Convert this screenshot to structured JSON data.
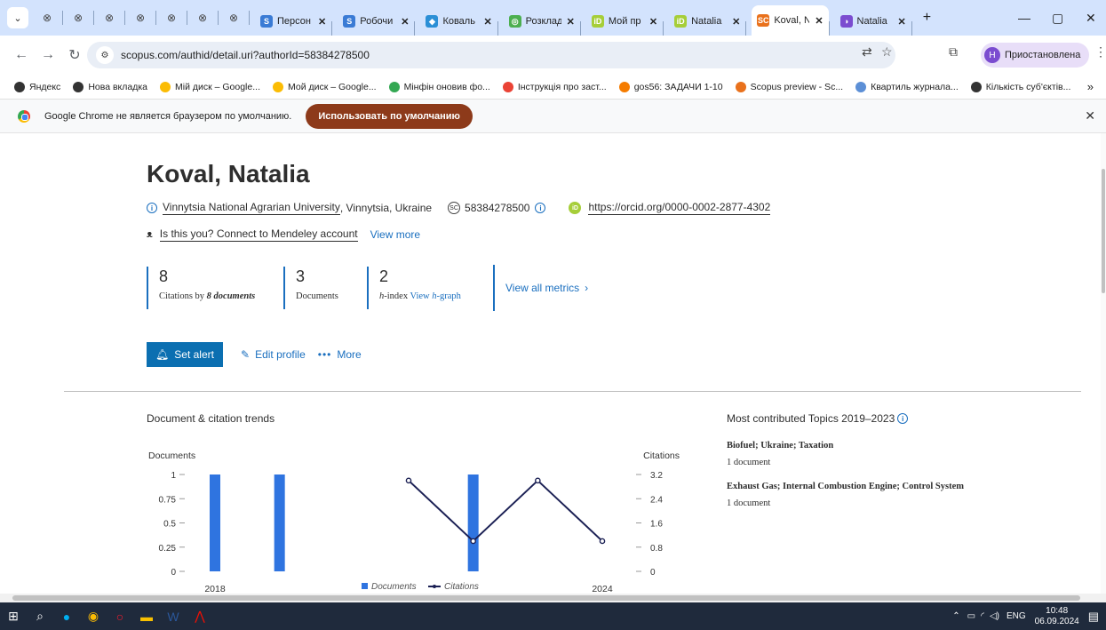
{
  "browser": {
    "tabs": [
      {
        "label": "Персон",
        "icon": "S",
        "color": "#3a7bd5"
      },
      {
        "label": "Робочи",
        "icon": "S",
        "color": "#3a7bd5"
      },
      {
        "label": "Коваль",
        "icon": "◆",
        "color": "#2b8fd6"
      },
      {
        "label": "Розклад",
        "icon": "◎",
        "color": "#4caf50"
      },
      {
        "label": "Мой пр",
        "icon": "iD",
        "color": "#a6ce39"
      },
      {
        "label": "Natalia",
        "icon": "iD",
        "color": "#a6ce39"
      },
      {
        "label": "Koval, N",
        "icon": "SC",
        "color": "#e9711c",
        "active": true
      },
      {
        "label": "Natalia",
        "icon": "◑",
        "color": "#7b4cd0"
      }
    ],
    "url": "scopus.com/authid/detail.uri?authorId=58384278500",
    "profile_label": "Приостановлена",
    "profile_initial": "Н",
    "bookmarks": [
      {
        "label": "Яндекс",
        "color": "#333"
      },
      {
        "label": "Нова вкладка",
        "color": "#333"
      },
      {
        "label": "Мій диск – Google...",
        "color": "#fbbc04"
      },
      {
        "label": "Мой диск – Google...",
        "color": "#fbbc04"
      },
      {
        "label": "Мінфін оновив фо...",
        "color": "#34a853"
      },
      {
        "label": "Інструкція про заст...",
        "color": "#ea4335"
      },
      {
        "label": "gos56: ЗАДАЧИ 1-10",
        "color": "#f57c00"
      },
      {
        "label": "Scopus preview - Sc...",
        "color": "#e9711c"
      },
      {
        "label": "Квартиль журнала...",
        "color": "#5c8fd6"
      },
      {
        "label": "Кількість суб'єктів...",
        "color": "#333"
      }
    ],
    "infobar_text": "Google Chrome не является браузером по умолчанию.",
    "infobar_button": "Использовать по умолчанию"
  },
  "profile": {
    "name": "Koval, Natalia",
    "affiliation": "Vinnytsia National Agrarian University",
    "location": ", Vinnytsia, Ukraine",
    "scopus_id": "58384278500",
    "orcid": "https://orcid.org/0000-0002-2877-4302",
    "mendeley": "Is this you? Connect to Mendeley account",
    "view_more": "View more"
  },
  "metrics": {
    "citations": "8",
    "citations_label_prefix": "Citations by ",
    "citations_label_em": "8 documents",
    "documents": "3",
    "documents_label": "Documents",
    "hindex": "2",
    "hindex_label_em": "h",
    "hindex_label": "-index ",
    "hgraph_link": "View ",
    "hgraph_em": "h",
    "hgraph_link2": "-graph",
    "view_all": "View all metrics"
  },
  "actions": {
    "set_alert": "Set alert",
    "edit_profile": "Edit profile",
    "more": "More"
  },
  "trends_title": "Document & citation trends",
  "topics": {
    "title": "Most contributed Topics 2019–2023",
    "items": [
      {
        "name": "Biofuel; Ukraine; Taxation",
        "count": "1 document"
      },
      {
        "name": "Exhaust Gas; Internal Combustion Engine; Control System",
        "count": "1 document"
      }
    ]
  },
  "chart_data": {
    "type": "bar",
    "left_axis_label": "Documents",
    "right_axis_label": "Citations",
    "left_ticks": [
      "1",
      "0.75",
      "0.5",
      "0.25",
      "0"
    ],
    "right_ticks": [
      "3.2",
      "2.4",
      "1.6",
      "0.8",
      "0"
    ],
    "x_tick_labels": [
      "2018",
      "2024"
    ],
    "ylim_documents": [
      0,
      1
    ],
    "ylim_citations": [
      0,
      3.2
    ],
    "x": [
      2018,
      2019,
      2020,
      2021,
      2022,
      2023,
      2024
    ],
    "series": [
      {
        "name": "Documents",
        "kind": "bar",
        "color": "#2f74e0",
        "values": [
          1,
          1,
          0,
          0,
          1,
          0,
          0
        ]
      },
      {
        "name": "Citations",
        "kind": "line",
        "color": "#1b2054",
        "values": [
          null,
          null,
          null,
          3,
          1,
          3,
          1
        ]
      }
    ],
    "legend": [
      "Documents",
      "Citations"
    ]
  },
  "taskbar": {
    "lang": "ENG",
    "time": "10:48",
    "date": "06.09.2024"
  }
}
